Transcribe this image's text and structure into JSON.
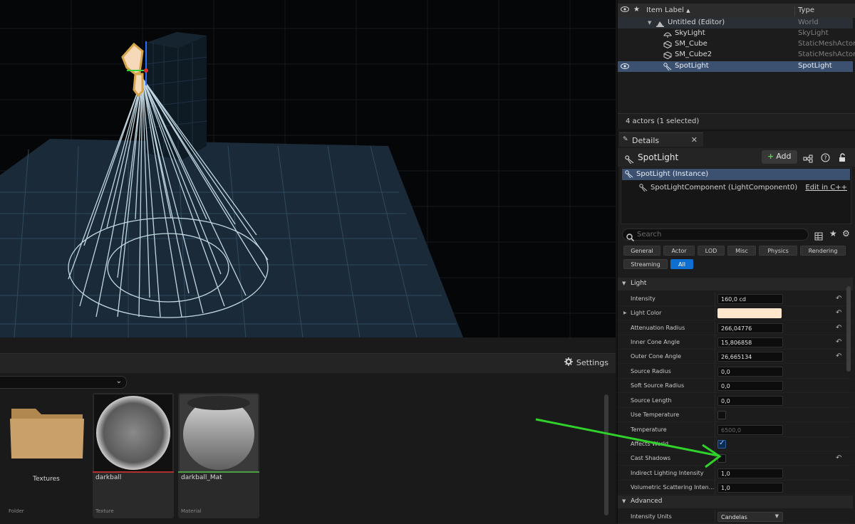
{
  "outliner": {
    "col_label": "Item Label",
    "col_type": "Type",
    "rows": [
      {
        "name": "Untitled (Editor)",
        "type": "World"
      },
      {
        "name": "SkyLight",
        "type": "SkyLight"
      },
      {
        "name": "SM_Cube",
        "type": "StaticMeshActor"
      },
      {
        "name": "SM_Cube2",
        "type": "StaticMeshActor"
      },
      {
        "name": "SpotLight",
        "type": "SpotLight"
      }
    ],
    "footer": "4 actors (1 selected)"
  },
  "details": {
    "tab_label": "Details",
    "actor_name": "SpotLight",
    "add_label": "Add",
    "instance_label": "SpotLight (Instance)",
    "component_label": "SpotLightComponent (LightComponent0)",
    "edit_cpp": "Edit in C++",
    "search_placeholder": "Search",
    "filters": [
      "General",
      "Actor",
      "LOD",
      "Misc",
      "Physics",
      "Rendering",
      "Streaming",
      "All"
    ],
    "section_light": "Light",
    "section_advanced": "Advanced",
    "props": {
      "intensity": {
        "label": "Intensity",
        "value": "160,0 cd"
      },
      "light_color": {
        "label": "Light Color",
        "color": "#ffe6cc"
      },
      "attenuation": {
        "label": "Attenuation Radius",
        "value": "266,04776"
      },
      "inner_cone": {
        "label": "Inner Cone Angle",
        "value": "15,806858"
      },
      "outer_cone": {
        "label": "Outer Cone Angle",
        "value": "26,665134"
      },
      "source_radius": {
        "label": "Source Radius",
        "value": "0,0"
      },
      "soft_source_radius": {
        "label": "Soft Source Radius",
        "value": "0,0"
      },
      "source_length": {
        "label": "Source Length",
        "value": "0,0"
      },
      "use_temperature": {
        "label": "Use Temperature",
        "checked": false
      },
      "temperature": {
        "label": "Temperature",
        "value": "6500,0"
      },
      "affects_world": {
        "label": "Affects World",
        "checked": true
      },
      "cast_shadows": {
        "label": "Cast Shadows",
        "checked": false
      },
      "indirect": {
        "label": "Indirect Lighting Intensity",
        "value": "1,0"
      },
      "volumetric": {
        "label": "Volumetric Scattering Inten...",
        "value": "1,0"
      },
      "intensity_units": {
        "label": "Intensity Units",
        "value": "Candelas"
      }
    }
  },
  "content_browser": {
    "settings_label": "Settings",
    "items": [
      {
        "name": "Textures",
        "type": "Folder"
      },
      {
        "name": "darkball",
        "type": "Texture",
        "accent": "#b03030"
      },
      {
        "name": "darkball_Mat",
        "type": "Material",
        "accent": "#4aa043"
      }
    ]
  },
  "colors": {
    "selection": "#3c5170",
    "accent_blue": "#0e6fd0",
    "annotation_arrow": "#2fd12a"
  }
}
